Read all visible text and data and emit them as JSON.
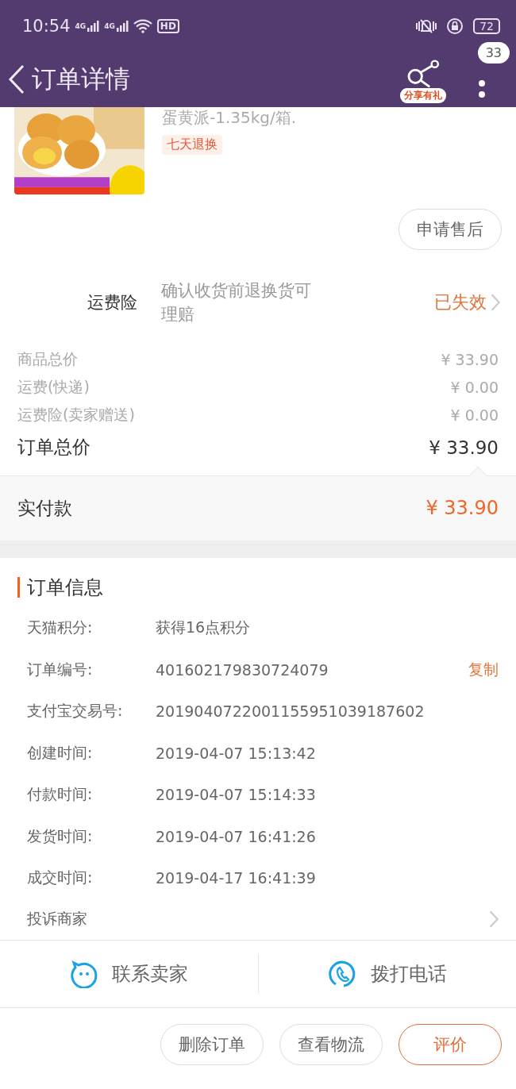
{
  "status_bar": {
    "time": "10:54",
    "signals": [
      "4G",
      "4G"
    ],
    "hd": "HD",
    "battery": "72"
  },
  "header": {
    "title": "订单详情",
    "share_label": "分享有礼",
    "badge": "33"
  },
  "product": {
    "title": "蛋黄派-1.35kg/箱.",
    "tag": "七天退换",
    "after_sale_button": "申请售后"
  },
  "insurance": {
    "label": "运费险",
    "description": "确认收货前退换货可理赔",
    "status": "已失效"
  },
  "price_lines": [
    {
      "label": "商品总价",
      "value": "¥ 33.90"
    },
    {
      "label": "运费(快递)",
      "value": "¥ 0.00"
    },
    {
      "label": "运费险(卖家赠送)",
      "value": "¥ 0.00"
    }
  ],
  "order_total": {
    "label": "订单总价",
    "value": "¥ 33.90"
  },
  "paid": {
    "label": "实付款",
    "value": "¥ 33.90"
  },
  "order_info": {
    "title": "订单信息",
    "rows": [
      {
        "kind": "field",
        "label": "天猫积分:",
        "value": "获得16点积分"
      },
      {
        "kind": "field",
        "label": "订单编号:",
        "value": "401602179830724079",
        "action": "复制"
      },
      {
        "kind": "field",
        "label": "支付宝交易号:",
        "value": "2019040722001155951039187602"
      },
      {
        "kind": "field",
        "label": "创建时间:",
        "value": "2019-04-07 15:13:42"
      },
      {
        "kind": "field",
        "label": "付款时间:",
        "value": "2019-04-07 15:14:33"
      },
      {
        "kind": "field",
        "label": "发货时间:",
        "value": "2019-04-07 16:41:26"
      },
      {
        "kind": "field",
        "label": "成交时间:",
        "value": "2019-04-17 16:41:39"
      },
      {
        "kind": "link",
        "label": "投诉商家"
      }
    ]
  },
  "contacts": [
    {
      "kind": "chat",
      "label": "联系卖家"
    },
    {
      "kind": "phone",
      "label": "拨打电话"
    }
  ],
  "actions": [
    {
      "label": "删除订单",
      "primary": false
    },
    {
      "label": "查看物流",
      "primary": false
    },
    {
      "label": "评价",
      "primary": true
    }
  ]
}
